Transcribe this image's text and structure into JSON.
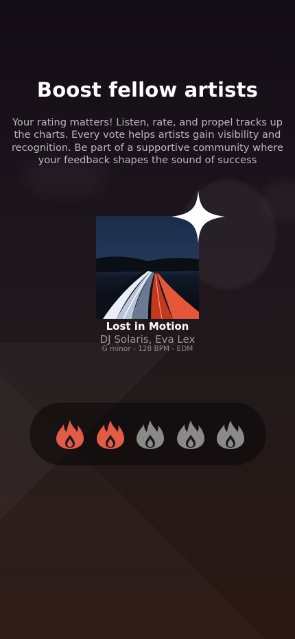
{
  "onboarding": {
    "title": "Boost fellow artists",
    "description": "Your rating matters! Listen, rate, and propel tracks up the charts. Every vote helps artists gain visibility and recognition. Be part of a supportive community where your feedback shapes the sound of success"
  },
  "track": {
    "title": "Lost in Motion",
    "artists": "DJ Solaris, Eva Lex",
    "meta": "G minor - 128 BPM - EDM"
  },
  "rating": {
    "value": 2,
    "max": 5,
    "icon": "flame-icon",
    "active_color": "#e15b49",
    "inactive_color": "#8a8a8a"
  }
}
